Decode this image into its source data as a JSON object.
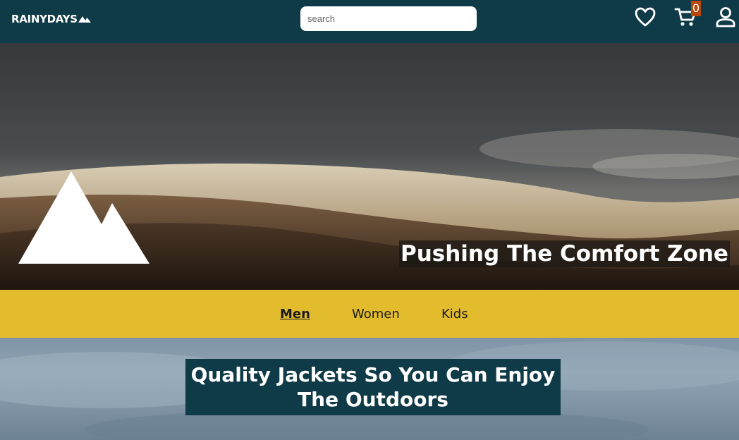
{
  "header": {
    "logo_text": "RAINYDAYS",
    "logo_icon": "mountains-icon",
    "search_placeholder": "search",
    "favorites_icon": "heart-icon",
    "cart_icon": "cart-icon",
    "cart_count": "0",
    "account_icon": "user-icon"
  },
  "hero": {
    "title": "Pushing The Comfort Zone",
    "mountain_icon": "mountain-icon"
  },
  "categories": [
    {
      "label": "Men",
      "active": true
    },
    {
      "label": "Women",
      "active": false
    },
    {
      "label": "Kids",
      "active": false
    }
  ],
  "banner2": {
    "title_line1": "Quality Jackets So You Can Enjoy",
    "title_line2": "The Outdoors"
  },
  "colors": {
    "header_bg": "#0f3a47",
    "nav_bg": "#e3bc2e",
    "cart_badge": "#b8470a",
    "banner_title_bg": "#0f3a47"
  }
}
